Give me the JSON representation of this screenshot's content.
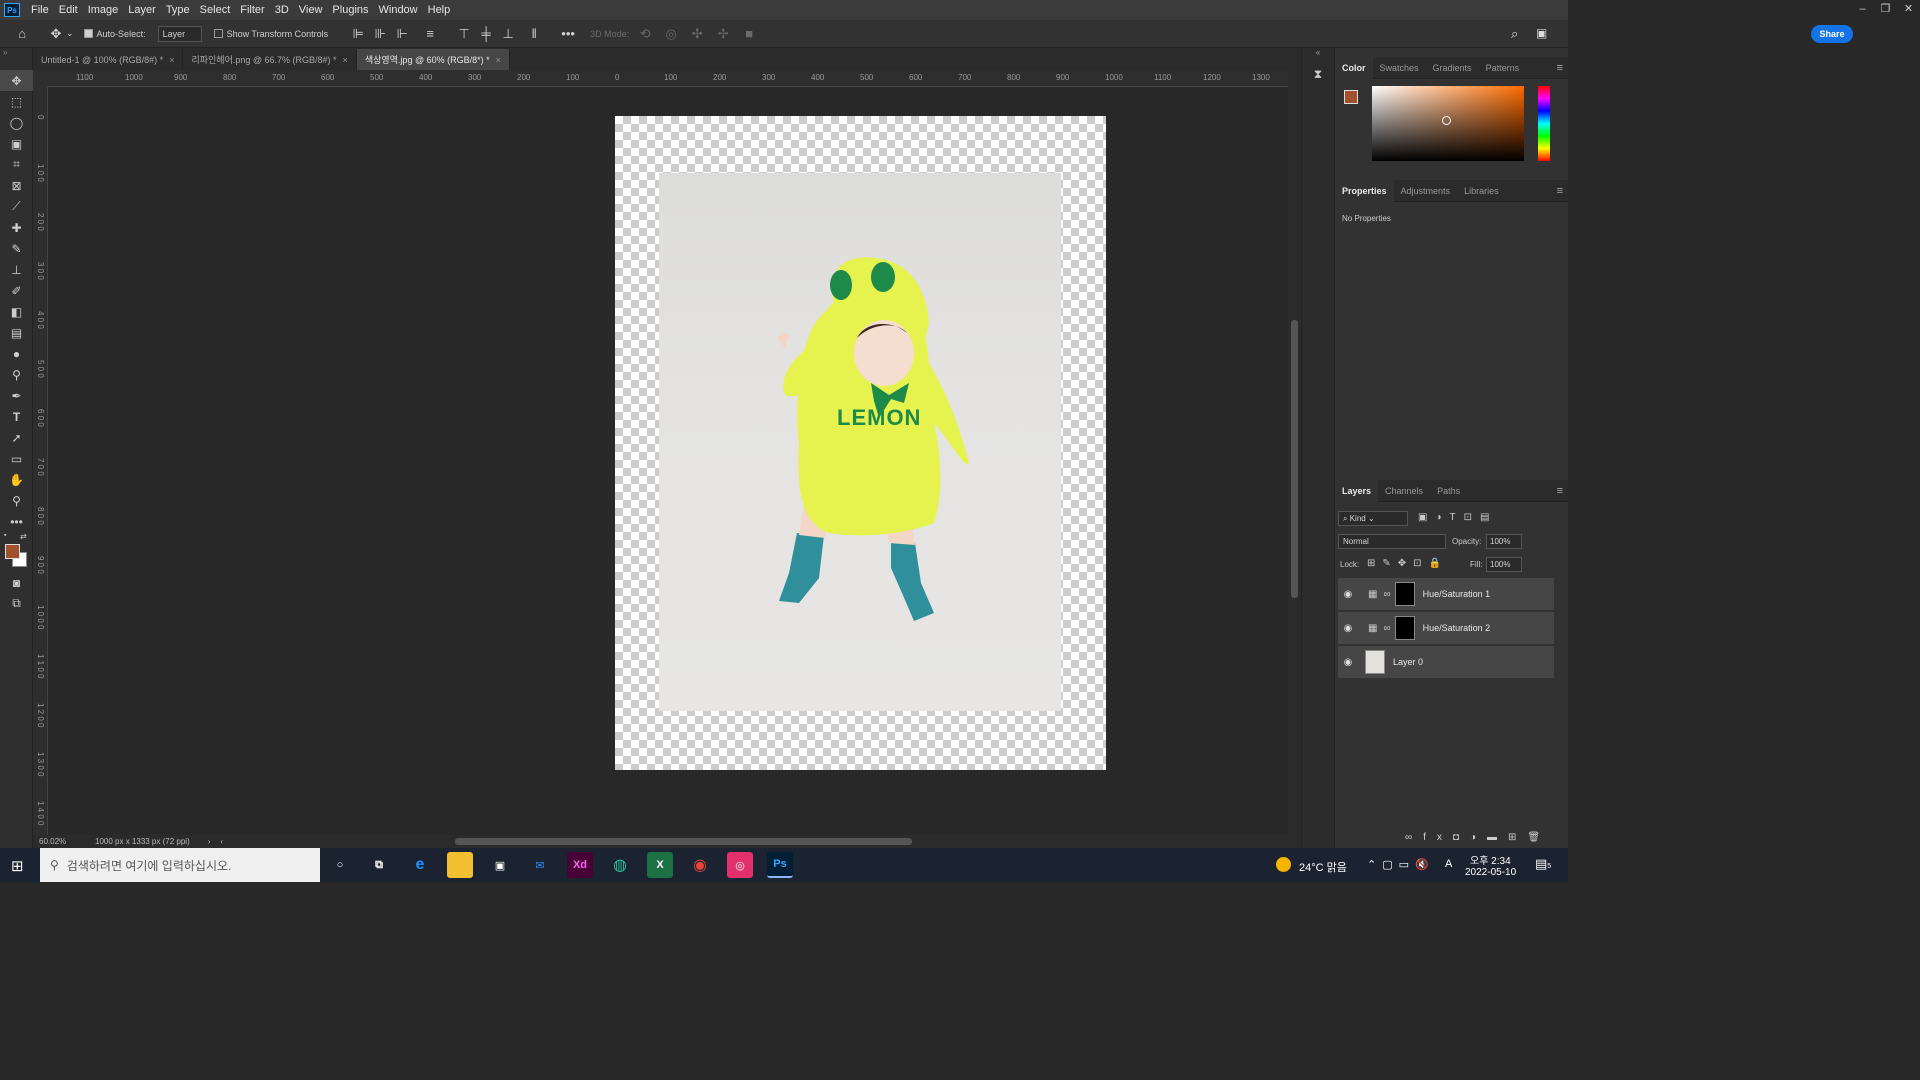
{
  "menubar": {
    "logo": "Ps",
    "items": [
      "File",
      "Edit",
      "Image",
      "Layer",
      "Type",
      "Select",
      "Filter",
      "3D",
      "View",
      "Plugins",
      "Window",
      "Help"
    ]
  },
  "options": {
    "auto_select_label": "Auto-Select:",
    "auto_select_value": "Layer",
    "show_transform_label": "Show Transform Controls",
    "mode_3d_label": "3D Mode:",
    "share_label": "Share"
  },
  "tabs": [
    {
      "label": "Untitled-1 @ 100% (RGB/8#) *"
    },
    {
      "label": "리파인헤어.png @ 66.7% (RGB/8#) *"
    },
    {
      "label": "색상영역.jpg @ 60% (RGB/8*) *"
    }
  ],
  "ruler_top": [
    "1100",
    "1000",
    "900",
    "800",
    "700",
    "600",
    "500",
    "400",
    "300",
    "200",
    "100",
    "0",
    "100",
    "200",
    "300",
    "400",
    "500",
    "600",
    "700",
    "800",
    "900",
    "1000",
    "1100",
    "1200",
    "1300"
  ],
  "ruler_left": [
    "0",
    "1 0 0",
    "2 0 0",
    "3 0 0",
    "4 0 0",
    "5 0 0",
    "6 0 0",
    "7 0 0",
    "8 0 0",
    "9 0 0",
    "1 0 0 0",
    "1 1 0 0",
    "1 2 0 0",
    "1 3 0 0",
    "1 4 0 0"
  ],
  "photo": {
    "text": "LEMON"
  },
  "status": {
    "zoom": "60.02%",
    "size": "1000 px x 1333 px (72 ppi)"
  },
  "color_panel": {
    "tabs": [
      "Color",
      "Swatches",
      "Gradients",
      "Patterns"
    ],
    "foreground": "#a0522d",
    "background": "#ffffff"
  },
  "properties_panel": {
    "tabs": [
      "Properties",
      "Adjustments",
      "Libraries"
    ],
    "empty_text": "No Properties"
  },
  "layers_panel": {
    "tabs": [
      "Layers",
      "Channels",
      "Paths"
    ],
    "kind_label": "Kind",
    "blend_mode": "Normal",
    "opacity_label": "Opacity:",
    "opacity_value": "100%",
    "lock_label": "Lock:",
    "fill_label": "Fill:",
    "fill_value": "100%",
    "layers": [
      {
        "name": "Hue/Saturation 1"
      },
      {
        "name": "Hue/Saturation 2"
      },
      {
        "name": "Layer 0"
      }
    ]
  },
  "taskbar": {
    "search_placeholder": "검색하려면 여기에 입력하십시오.",
    "weather": "24°C 맑음",
    "time": "오후 2:34",
    "date": "2022-05-10",
    "notif_count": "5",
    "ime": "A"
  }
}
